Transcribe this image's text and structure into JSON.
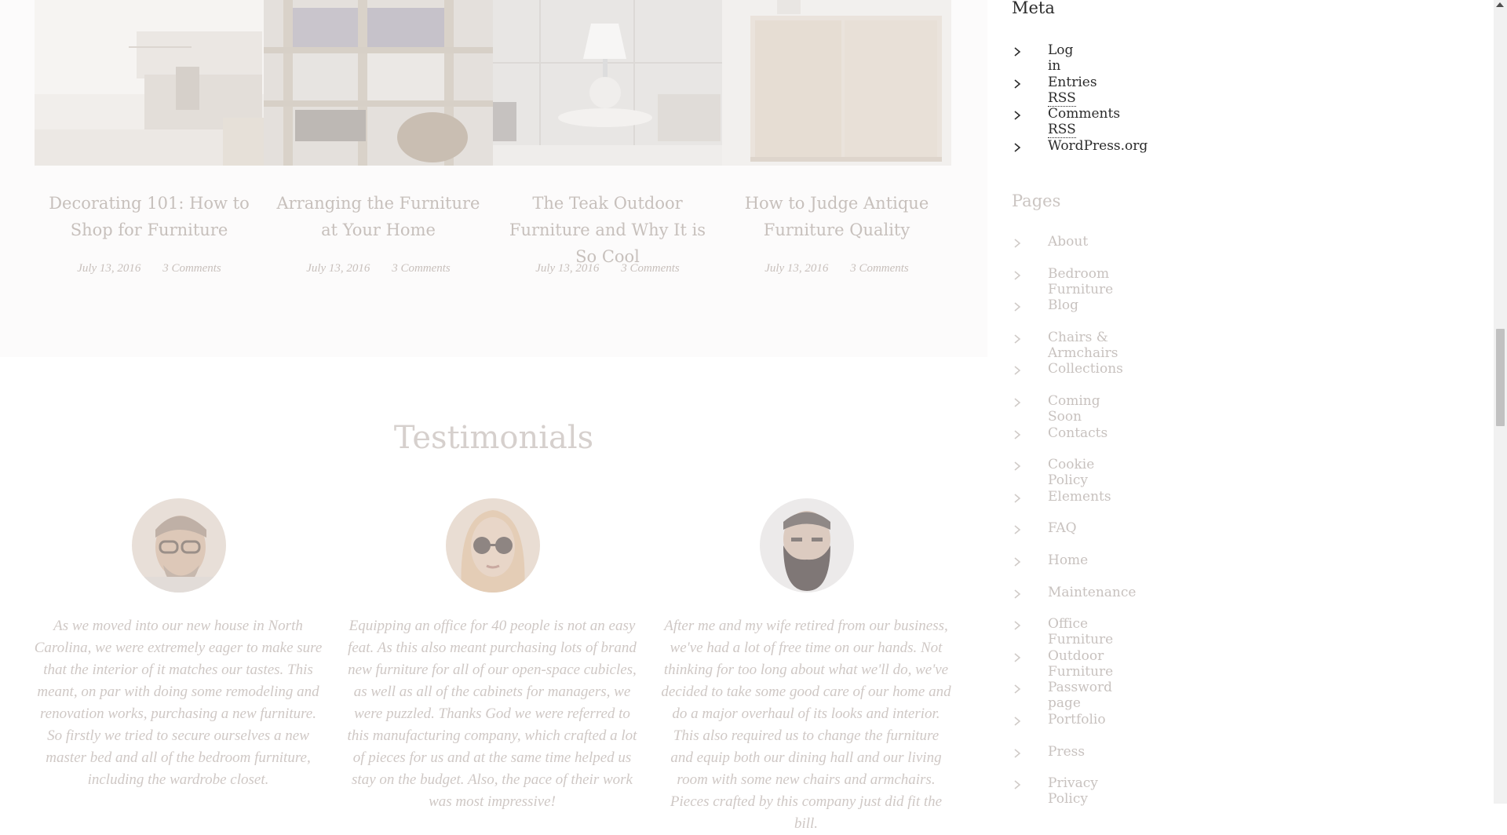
{
  "blog": {
    "posts": [
      {
        "title": "Decorating 101: How to Shop for Furniture",
        "date": "July 13, 2016",
        "comments": "3 Comments"
      },
      {
        "title": "Arranging the Furniture at Your Home",
        "date": "July 13, 2016",
        "comments": "3 Comments"
      },
      {
        "title": "The Teak Outdoor Furniture and Why It is So Cool",
        "date": "July 13, 2016",
        "comments": "3 Comments"
      },
      {
        "title": "How to Judge Antique Furniture Quality",
        "date": "July 13, 2016",
        "comments": "3 Comments"
      }
    ]
  },
  "testimonials": {
    "title": "Testimonials",
    "items": [
      {
        "quote": "As we moved into our new house in North Carolina, we were extremely eager to make sure that the interior of it matches our tastes. This meant, on par with doing some remodeling and renovation works, purchasing a new furniture. So firstly we tried to secure ourselves a new master bed and all of the bedroom furniture, including the wardrobe closet."
      },
      {
        "quote": "Equipping an office for 40 people is not an easy feat. As this also meant purchasing lots of brand new furniture for all of our open-space cubicles, as well as all of the cabinets for managers, we were puzzled. Thanks God we were referred to this manufacturing company, which crafted a lot of pieces for us and at the same time helped us stay on the budget. Also, the pace of their work was most impressive!"
      },
      {
        "quote": "After me and my wife retired from our business, we've had a lot of free time on our hands. Not thinking for too long about what we'll do, we've decided to take some good care of our home and do a major overhaul of its looks and interior. This also required us to change the furniture and equip both our dining hall and our living room with some new chairs and armchairs. Pieces crafted by this company just did fit the bill."
      }
    ]
  },
  "sidebar": {
    "meta": {
      "title": "Meta",
      "items": [
        {
          "label": "Log in",
          "abbr": ""
        },
        {
          "label": "Entries ",
          "abbr": "RSS"
        },
        {
          "label": "Comments ",
          "abbr": "RSS"
        },
        {
          "label": "WordPress.org",
          "abbr": ""
        }
      ]
    },
    "pages": {
      "title": "Pages",
      "items": [
        "About",
        "Bedroom Furniture",
        "Blog",
        "Chairs & Armchairs",
        "Collections",
        "Coming Soon",
        "Contacts",
        "Cookie Policy",
        "Elements",
        "FAQ",
        "Home",
        "Maintenance",
        "Office Furniture",
        "Outdoor Furniture",
        "Password page",
        "Portfolio",
        "Press",
        "Privacy Policy"
      ]
    }
  },
  "colors": {
    "faded_text": "#c8c0bc",
    "heading": "#2b2b2b"
  }
}
